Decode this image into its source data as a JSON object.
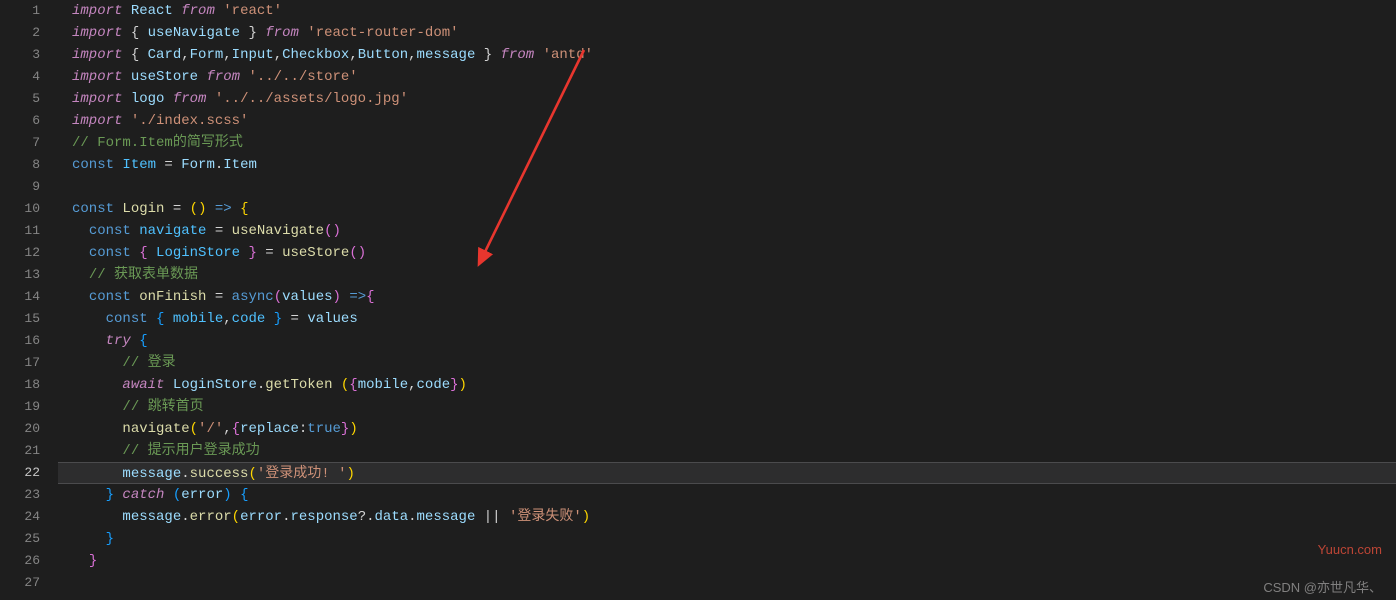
{
  "gutter": {
    "lines": [
      "1",
      "2",
      "3",
      "4",
      "5",
      "6",
      "7",
      "8",
      "9",
      "10",
      "11",
      "12",
      "13",
      "14",
      "15",
      "16",
      "17",
      "18",
      "19",
      "20",
      "21",
      "22",
      "23",
      "24",
      "25",
      "26",
      "27"
    ],
    "active_line": 22
  },
  "code": [
    {
      "n": 1,
      "tokens": [
        {
          "t": "import",
          "c": "k"
        },
        {
          "t": " ",
          "c": "p"
        },
        {
          "t": "React",
          "c": "id"
        },
        {
          "t": " ",
          "c": "p"
        },
        {
          "t": "from",
          "c": "k"
        },
        {
          "t": " ",
          "c": "p"
        },
        {
          "t": "'react'",
          "c": "s"
        }
      ]
    },
    {
      "n": 2,
      "tokens": [
        {
          "t": "import",
          "c": "k"
        },
        {
          "t": " { ",
          "c": "p"
        },
        {
          "t": "useNavigate",
          "c": "id"
        },
        {
          "t": " } ",
          "c": "p"
        },
        {
          "t": "from",
          "c": "k"
        },
        {
          "t": " ",
          "c": "p"
        },
        {
          "t": "'react-router-dom'",
          "c": "s"
        }
      ]
    },
    {
      "n": 3,
      "tokens": [
        {
          "t": "import",
          "c": "k"
        },
        {
          "t": " { ",
          "c": "p"
        },
        {
          "t": "Card",
          "c": "id"
        },
        {
          "t": ",",
          "c": "p"
        },
        {
          "t": "Form",
          "c": "id"
        },
        {
          "t": ",",
          "c": "p"
        },
        {
          "t": "Input",
          "c": "id"
        },
        {
          "t": ",",
          "c": "p"
        },
        {
          "t": "Checkbox",
          "c": "id"
        },
        {
          "t": ",",
          "c": "p"
        },
        {
          "t": "Button",
          "c": "id"
        },
        {
          "t": ",",
          "c": "p"
        },
        {
          "t": "message",
          "c": "id"
        },
        {
          "t": " } ",
          "c": "p"
        },
        {
          "t": "from",
          "c": "k"
        },
        {
          "t": " ",
          "c": "p"
        },
        {
          "t": "'antd'",
          "c": "s"
        }
      ]
    },
    {
      "n": 4,
      "tokens": [
        {
          "t": "import",
          "c": "k"
        },
        {
          "t": " ",
          "c": "p"
        },
        {
          "t": "useStore",
          "c": "id"
        },
        {
          "t": " ",
          "c": "p"
        },
        {
          "t": "from",
          "c": "k"
        },
        {
          "t": " ",
          "c": "p"
        },
        {
          "t": "'../../store'",
          "c": "s"
        }
      ]
    },
    {
      "n": 5,
      "tokens": [
        {
          "t": "import",
          "c": "k"
        },
        {
          "t": " ",
          "c": "p"
        },
        {
          "t": "logo",
          "c": "id"
        },
        {
          "t": " ",
          "c": "p"
        },
        {
          "t": "from",
          "c": "k"
        },
        {
          "t": " ",
          "c": "p"
        },
        {
          "t": "'../../assets/logo.jpg'",
          "c": "s"
        }
      ]
    },
    {
      "n": 6,
      "tokens": [
        {
          "t": "import",
          "c": "k"
        },
        {
          "t": " ",
          "c": "p"
        },
        {
          "t": "'./index.scss'",
          "c": "s"
        }
      ]
    },
    {
      "n": 7,
      "tokens": [
        {
          "t": "// Form.Item的简写形式",
          "c": "cm"
        }
      ]
    },
    {
      "n": 8,
      "tokens": [
        {
          "t": "const",
          "c": "kw"
        },
        {
          "t": " ",
          "c": "p"
        },
        {
          "t": "Item",
          "c": "vr"
        },
        {
          "t": " = ",
          "c": "p"
        },
        {
          "t": "Form",
          "c": "id"
        },
        {
          "t": ".",
          "c": "p"
        },
        {
          "t": "Item",
          "c": "id"
        }
      ]
    },
    {
      "n": 9,
      "tokens": []
    },
    {
      "n": 10,
      "tokens": [
        {
          "t": "const",
          "c": "kw"
        },
        {
          "t": " ",
          "c": "p"
        },
        {
          "t": "Login",
          "c": "fn"
        },
        {
          "t": " = ",
          "c": "p"
        },
        {
          "t": "(",
          "c": "yb"
        },
        {
          "t": ")",
          "c": "yb"
        },
        {
          "t": " ",
          "c": "p"
        },
        {
          "t": "=>",
          "c": "kw"
        },
        {
          "t": " ",
          "c": "p"
        },
        {
          "t": "{",
          "c": "yb"
        }
      ]
    },
    {
      "n": 11,
      "indent": 1,
      "tokens": [
        {
          "t": "const",
          "c": "kw"
        },
        {
          "t": " ",
          "c": "p"
        },
        {
          "t": "navigate",
          "c": "vr"
        },
        {
          "t": " = ",
          "c": "p"
        },
        {
          "t": "useNavigate",
          "c": "fn"
        },
        {
          "t": "(",
          "c": "pb"
        },
        {
          "t": ")",
          "c": "pb"
        }
      ]
    },
    {
      "n": 12,
      "indent": 1,
      "tokens": [
        {
          "t": "const",
          "c": "kw"
        },
        {
          "t": " ",
          "c": "p"
        },
        {
          "t": "{",
          "c": "pb"
        },
        {
          "t": " ",
          "c": "p"
        },
        {
          "t": "LoginStore",
          "c": "vr"
        },
        {
          "t": " ",
          "c": "p"
        },
        {
          "t": "}",
          "c": "pb"
        },
        {
          "t": " = ",
          "c": "p"
        },
        {
          "t": "useStore",
          "c": "fn"
        },
        {
          "t": "(",
          "c": "pb"
        },
        {
          "t": ")",
          "c": "pb"
        }
      ]
    },
    {
      "n": 13,
      "indent": 1,
      "tokens": [
        {
          "t": "// 获取表单数据",
          "c": "cm"
        }
      ]
    },
    {
      "n": 14,
      "indent": 1,
      "tokens": [
        {
          "t": "const",
          "c": "kw"
        },
        {
          "t": " ",
          "c": "p"
        },
        {
          "t": "onFinish",
          "c": "fn"
        },
        {
          "t": " = ",
          "c": "p"
        },
        {
          "t": "async",
          "c": "kw"
        },
        {
          "t": "(",
          "c": "pb"
        },
        {
          "t": "values",
          "c": "id"
        },
        {
          "t": ")",
          "c": "pb"
        },
        {
          "t": " ",
          "c": "p"
        },
        {
          "t": "=>",
          "c": "kw"
        },
        {
          "t": "{",
          "c": "pb"
        }
      ]
    },
    {
      "n": 15,
      "indent": 2,
      "tokens": [
        {
          "t": "const",
          "c": "kw"
        },
        {
          "t": " ",
          "c": "p"
        },
        {
          "t": "{",
          "c": "bb"
        },
        {
          "t": " ",
          "c": "p"
        },
        {
          "t": "mobile",
          "c": "vr"
        },
        {
          "t": ",",
          "c": "p"
        },
        {
          "t": "code",
          "c": "vr"
        },
        {
          "t": " ",
          "c": "p"
        },
        {
          "t": "}",
          "c": "bb"
        },
        {
          "t": " = ",
          "c": "p"
        },
        {
          "t": "values",
          "c": "id"
        }
      ]
    },
    {
      "n": 16,
      "indent": 2,
      "tokens": [
        {
          "t": "try",
          "c": "k"
        },
        {
          "t": " ",
          "c": "p"
        },
        {
          "t": "{",
          "c": "bb"
        }
      ]
    },
    {
      "n": 17,
      "indent": 3,
      "tokens": [
        {
          "t": "// 登录",
          "c": "cm"
        }
      ]
    },
    {
      "n": 18,
      "indent": 3,
      "tokens": [
        {
          "t": "await",
          "c": "k"
        },
        {
          "t": " ",
          "c": "p"
        },
        {
          "t": "LoginStore",
          "c": "id"
        },
        {
          "t": ".",
          "c": "p"
        },
        {
          "t": "getToken",
          "c": "fn"
        },
        {
          "t": " ",
          "c": "p"
        },
        {
          "t": "(",
          "c": "yb"
        },
        {
          "t": "{",
          "c": "pb"
        },
        {
          "t": "mobile",
          "c": "id"
        },
        {
          "t": ",",
          "c": "p"
        },
        {
          "t": "code",
          "c": "id"
        },
        {
          "t": "}",
          "c": "pb"
        },
        {
          "t": ")",
          "c": "yb"
        }
      ]
    },
    {
      "n": 19,
      "indent": 3,
      "tokens": [
        {
          "t": "// 跳转首页",
          "c": "cm"
        }
      ]
    },
    {
      "n": 20,
      "indent": 3,
      "tokens": [
        {
          "t": "navigate",
          "c": "fn"
        },
        {
          "t": "(",
          "c": "yb"
        },
        {
          "t": "'/'",
          "c": "s"
        },
        {
          "t": ",",
          "c": "p"
        },
        {
          "t": "{",
          "c": "pb"
        },
        {
          "t": "replace",
          "c": "id"
        },
        {
          "t": ":",
          "c": "p"
        },
        {
          "t": "true",
          "c": "kw"
        },
        {
          "t": "}",
          "c": "pb"
        },
        {
          "t": ")",
          "c": "yb"
        }
      ]
    },
    {
      "n": 21,
      "indent": 3,
      "tokens": [
        {
          "t": "// 提示用户登录成功",
          "c": "cm"
        }
      ]
    },
    {
      "n": 22,
      "indent": 3,
      "highlight": true,
      "tokens": [
        {
          "t": "message",
          "c": "id"
        },
        {
          "t": ".",
          "c": "p"
        },
        {
          "t": "success",
          "c": "fn"
        },
        {
          "t": "(",
          "c": "yb"
        },
        {
          "t": "'登录成功! '",
          "c": "s"
        },
        {
          "t": ")",
          "c": "yb"
        }
      ]
    },
    {
      "n": 23,
      "indent": 2,
      "tokens": [
        {
          "t": "}",
          "c": "bb"
        },
        {
          "t": " ",
          "c": "p"
        },
        {
          "t": "catch",
          "c": "k"
        },
        {
          "t": " ",
          "c": "p"
        },
        {
          "t": "(",
          "c": "bb"
        },
        {
          "t": "error",
          "c": "id"
        },
        {
          "t": ")",
          "c": "bb"
        },
        {
          "t": " ",
          "c": "p"
        },
        {
          "t": "{",
          "c": "bb"
        }
      ]
    },
    {
      "n": 24,
      "indent": 3,
      "tokens": [
        {
          "t": "message",
          "c": "id"
        },
        {
          "t": ".",
          "c": "p"
        },
        {
          "t": "error",
          "c": "fn"
        },
        {
          "t": "(",
          "c": "yb"
        },
        {
          "t": "error",
          "c": "id"
        },
        {
          "t": ".",
          "c": "p"
        },
        {
          "t": "response",
          "c": "id"
        },
        {
          "t": "?.",
          "c": "p"
        },
        {
          "t": "data",
          "c": "id"
        },
        {
          "t": ".",
          "c": "p"
        },
        {
          "t": "message",
          "c": "id"
        },
        {
          "t": " || ",
          "c": "p"
        },
        {
          "t": "'登录失败'",
          "c": "s"
        },
        {
          "t": ")",
          "c": "yb"
        }
      ]
    },
    {
      "n": 25,
      "indent": 2,
      "tokens": [
        {
          "t": "}",
          "c": "bb"
        }
      ]
    },
    {
      "n": 26,
      "indent": 1,
      "tokens": [
        {
          "t": "}",
          "c": "pb"
        }
      ]
    },
    {
      "n": 27,
      "indent": 1,
      "tokens": []
    }
  ],
  "watermarks": {
    "w1": "Yuucn.com",
    "w2": "CSDN @亦世凡华、"
  },
  "arrow": {
    "color": "#e8362e"
  }
}
